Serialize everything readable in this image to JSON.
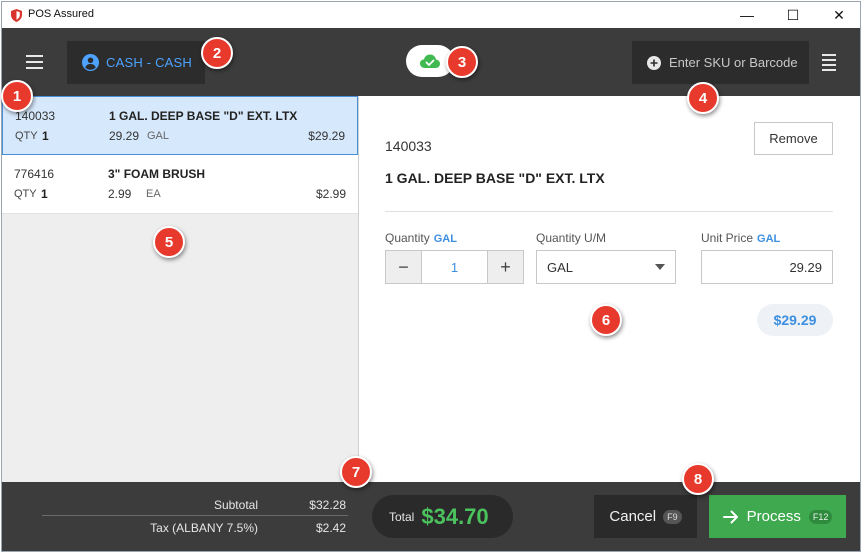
{
  "window": {
    "title": "POS Assured",
    "minimize_glyph": "—",
    "maximize_glyph": "☐",
    "close_glyph": "✕"
  },
  "header": {
    "customer_label": "CASH - CASH",
    "sku_placeholder": "Enter SKU or Barcode"
  },
  "items": [
    {
      "sku": "140033",
      "name": "1 GAL. DEEP BASE \"D\" EXT. LTX",
      "qty_label": "QTY",
      "qty": "1",
      "price": "29.29",
      "um": "GAL",
      "total": "$29.29"
    },
    {
      "sku": "776416",
      "name": "3\" FOAM BRUSH",
      "qty_label": "QTY",
      "qty": "1",
      "price": "2.99",
      "um": "EA",
      "total": "$2.99"
    }
  ],
  "detail": {
    "sku": "140033",
    "name": "1 GAL. DEEP BASE \"D\" EXT. LTX",
    "remove_label": "Remove",
    "quantity_label": "Quantity",
    "quantity_unit": "GAL",
    "quantity_value": "1",
    "minus_glyph": "−",
    "plus_glyph": "+",
    "um_label": "Quantity U/M",
    "um_value": "GAL",
    "unit_price_label": "Unit Price",
    "unit_price_unit": "GAL",
    "unit_price_value": "29.29",
    "line_total": "$29.29"
  },
  "footer": {
    "subtotal_label": "Subtotal",
    "subtotal_value": "$32.28",
    "tax_label": "Tax (ALBANY 7.5%)",
    "tax_value": "$2.42",
    "total_label": "Total",
    "total_value": "$34.70",
    "cancel_label": "Cancel",
    "cancel_key": "F9",
    "process_label": "Process",
    "process_key": "F12"
  },
  "callouts": [
    "1",
    "2",
    "3",
    "4",
    "5",
    "6",
    "7",
    "8"
  ],
  "colors": {
    "accent_blue": "#4da3ff",
    "process_green": "#3ea94e",
    "total_green": "#4cc25e",
    "callout_red": "#e83a2c",
    "header_dark": "#3c3c3c"
  }
}
